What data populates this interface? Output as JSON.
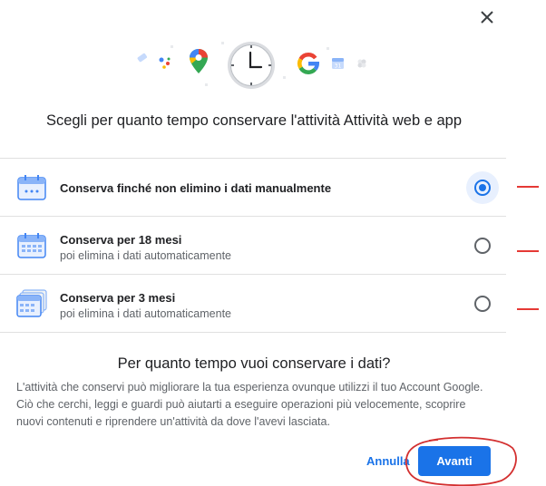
{
  "dialog": {
    "close_icon": "close-icon",
    "hero_icons": [
      "tag-icon",
      "assistant-icon",
      "maps-pin-icon",
      "clock-icon",
      "google-g-icon",
      "calendar-app-icon",
      "photos-icon"
    ],
    "title": "Scegli per quanto tempo conservare l'attività Attività web e app",
    "options": [
      {
        "title": "Conserva finché non elimino i dati manualmente",
        "subtitle": "",
        "selected": true,
        "icon": "calendar-manual-icon"
      },
      {
        "title": "Conserva per 18 mesi",
        "subtitle": "poi elimina i dati automaticamente",
        "selected": false,
        "icon": "calendar-18-months-icon"
      },
      {
        "title": "Conserva per 3 mesi",
        "subtitle": "poi elimina i dati automaticamente",
        "selected": false,
        "icon": "calendar-3-months-icon"
      }
    ],
    "question_title": "Per quanto tempo vuoi conservare i dati?",
    "question_body": "L'attività che conservi può migliorare la tua esperienza ovunque utilizzi il tuo Account Google. Ciò che cerchi, leggi e guardi può aiutarti a eseguire operazioni più velocemente, scoprire nuovi contenuti e riprendere un'attività da dove l'avevi lasciata.",
    "cancel_label": "Annulla",
    "next_label": "Avanti"
  },
  "colors": {
    "accent": "#1a73e8",
    "annotation": "#e53935"
  }
}
